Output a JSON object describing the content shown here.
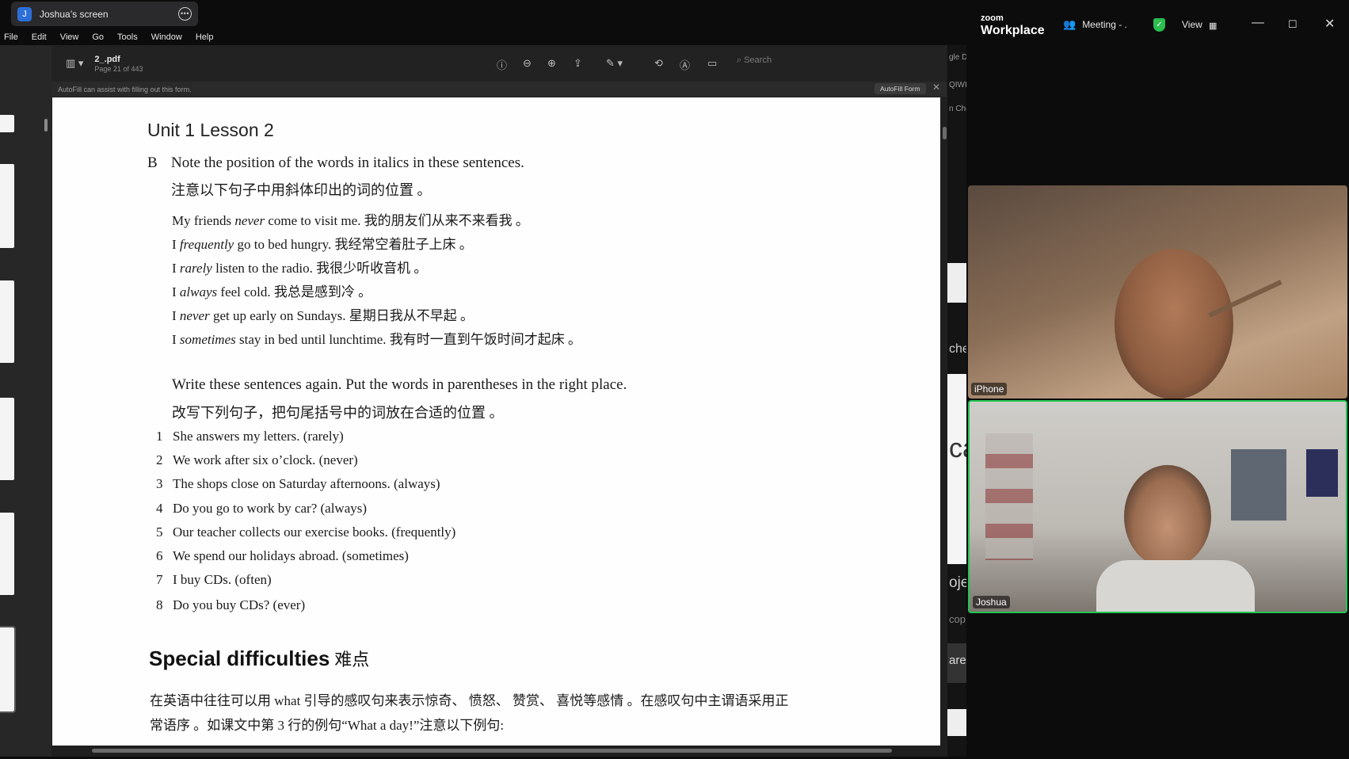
{
  "share": {
    "avatar_letter": "J",
    "title": "Joshua’s screen"
  },
  "menubar": [
    "File",
    "Edit",
    "View",
    "Go",
    "Tools",
    "Window",
    "Help"
  ],
  "viewer": {
    "doc_title": "2_.pdf",
    "page_info": "Page 21 of 443",
    "search_placeholder": "Search",
    "autofill_message": "AutoFill can assist with filling out this form.",
    "autofill_button": "AutoFill Form"
  },
  "page": {
    "unit_title": "Unit 1   Lesson 2",
    "section_letter": "B",
    "instruction_en": "Note the position of the words in italics in these sentences.",
    "instruction_cn": "注意以下句子中用斜体印出的词的位置 。",
    "examples": [
      {
        "pre": "My friends ",
        "adv": "never",
        "post": " come to visit me. 我的朋友们从来不来看我 。"
      },
      {
        "pre": "I ",
        "adv": "frequently",
        "post": " go to bed hungry. 我经常空着肚子上床 。"
      },
      {
        "pre": "I ",
        "adv": "rarely",
        "post": " listen to the radio. 我很少听收音机 。"
      },
      {
        "pre": "I ",
        "adv": "always",
        "post": " feel cold. 我总是感到冷 。"
      },
      {
        "pre": "I ",
        "adv": "never",
        "post": " get up early on Sundays. 星期日我从不早起 。"
      },
      {
        "pre": "I ",
        "adv": "sometimes",
        "post": " stay in bed until lunchtime. 我有时一直到午饭时间才起床 。"
      }
    ],
    "exercise_en": "Write these sentences again. Put the words in parentheses in the right place.",
    "exercise_cn": "改写下列句子，把句尾括号中的词放在合适的位置 。",
    "exercises": [
      {
        "n": "1",
        "text": "She answers my letters. (rarely)"
      },
      {
        "n": "2",
        "text": "We work after six o’clock. (never)"
      },
      {
        "n": "3",
        "text": "The shops close on Saturday afternoons. (always)"
      },
      {
        "n": "4",
        "text": "Do you go to work by car? (always)"
      },
      {
        "n": "5",
        "text": "Our teacher collects our exercise books. (frequently)"
      },
      {
        "n": "6",
        "text": "We spend our holidays abroad. (sometimes)"
      },
      {
        "n": "7",
        "text": "I buy CDs. (often)"
      },
      {
        "n": "8",
        "text": "Do you buy CDs? (ever)"
      }
    ],
    "special_title": "Special difficulties",
    "special_cn": "难点",
    "para_line1": "在英语中往往可以用 what 引导的感叹句来表示惊奇、 愤怒、 赞赏、 喜悦等感情 。在感叹句中主谓语采用正",
    "para_line2": "常语序 。如课文中第 3 行的例句“What a day!”注意以下例句:"
  },
  "strip_tabs": [
    "gle D",
    "QIWI",
    "n Che",
    "che",
    "ca",
    "oje",
    "cop",
    "are"
  ],
  "zoom": {
    "brand_small": "zoom",
    "brand_large": "Workplace",
    "meeting_label": "Meeting - .",
    "view_label": "View",
    "participants": [
      {
        "name": "iPhone"
      },
      {
        "name": "Joshua"
      }
    ]
  }
}
